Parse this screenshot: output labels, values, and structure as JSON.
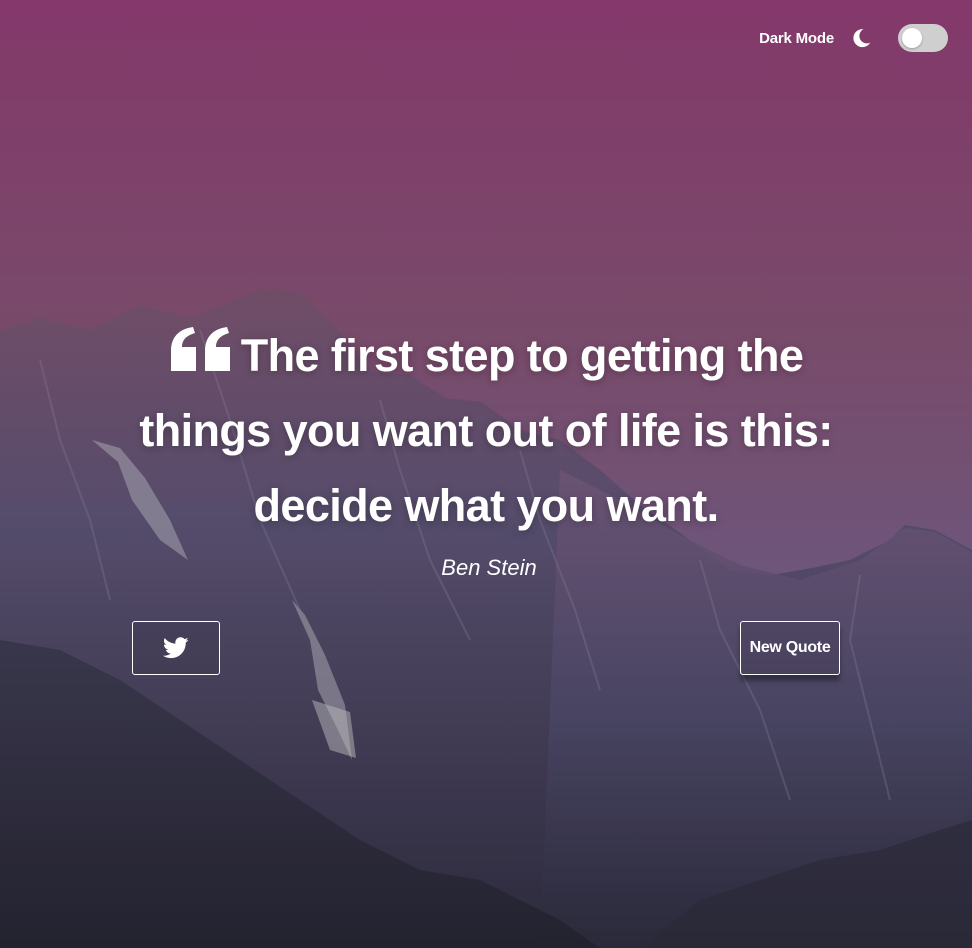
{
  "theme_switch": {
    "label": "Dark Mode",
    "icon": "moon-icon",
    "toggle_state": "off"
  },
  "quote": {
    "mark_icon": "quote-left-icon",
    "text": "The first step to getting the things you want out of life is this: decide what you want.",
    "author": "Ben Stein"
  },
  "buttons": {
    "twitter_icon": "twitter-icon",
    "new_quote_label": "New Quote"
  },
  "colors": {
    "sky_top": "#913e76",
    "sky_bottom": "#7a5b8c",
    "mountain": "#4f4a6c",
    "text": "#ffffff",
    "toggle_track": "#cfcfcf"
  }
}
